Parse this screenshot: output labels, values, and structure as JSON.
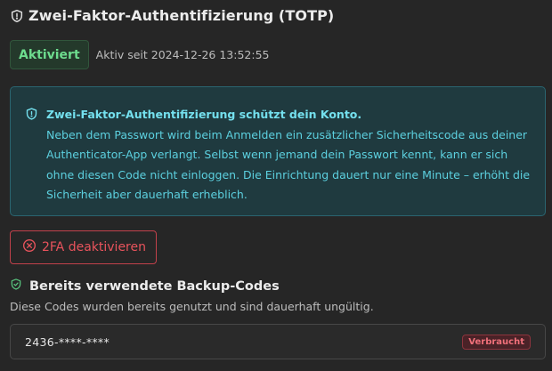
{
  "header": {
    "title": "Zwei-Faktor-Authentifizierung (TOTP)",
    "icon": "shield-icon"
  },
  "status": {
    "badge_label": "Aktiviert",
    "since_text": "Aktiv seit 2024-12-26 13:52:55"
  },
  "info": {
    "icon": "shield-icon",
    "title": "Zwei-Faktor-Authentifizierung schützt dein Konto.",
    "body": "Neben dem Passwort wird beim Anmelden ein zusätzlicher Sicherheitscode aus deiner Authenticator-App verlangt. Selbst wenn jemand dein Passwort kennt, kann er sich ohne diesen Code nicht einloggen. Die Einrichtung dauert nur eine Minute – erhöht die Sicherheit aber dauerhaft erheblich."
  },
  "actions": {
    "deactivate_label": "2FA deaktivieren",
    "deactivate_icon": "x-circle-icon"
  },
  "backup_codes": {
    "icon": "shield-check-icon",
    "title": "Bereits verwendete Backup-Codes",
    "subtitle": "Diese Codes wurden bereits genutzt und sind dauerhaft ungültig.",
    "items": [
      {
        "code": "2436-****-****",
        "status": "Verbraucht"
      }
    ]
  },
  "colors": {
    "background": "#262626",
    "success": "#6ddc8e",
    "info": "#5fd6e6",
    "danger": "#e8535c"
  }
}
